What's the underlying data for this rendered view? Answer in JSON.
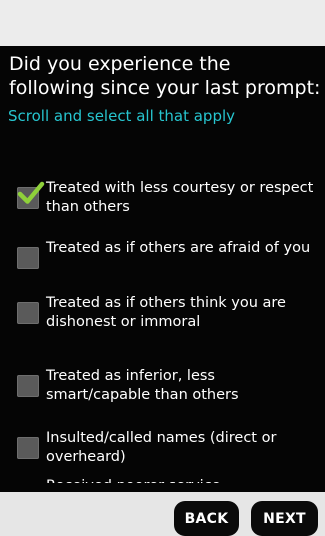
{
  "survey": {
    "question": "Did you experience the following since your last prompt:",
    "instruction": "Scroll and select all that apply",
    "options": [
      {
        "label": "Treated with less courtesy or respect than others",
        "checked": true
      },
      {
        "label": "Treated as if others are afraid of you",
        "checked": false
      },
      {
        "label": "Treated as if others think you are dishonest or immoral",
        "checked": false
      },
      {
        "label": "Treated as inferior, less smart/capable than others",
        "checked": false
      },
      {
        "label": "Insulted/called names (direct or overheard)",
        "checked": false
      }
    ],
    "partial_option_label": "Received poorer service..."
  },
  "nav": {
    "back_label": "BACK",
    "next_label": "NEXT"
  },
  "colors": {
    "screen_background": "#050505",
    "instruction_text": "#27c5cf",
    "checkmark": "#8fd13a",
    "checkbox": "#5a5a5a"
  },
  "icons": {
    "checkmark": "check-icon"
  }
}
